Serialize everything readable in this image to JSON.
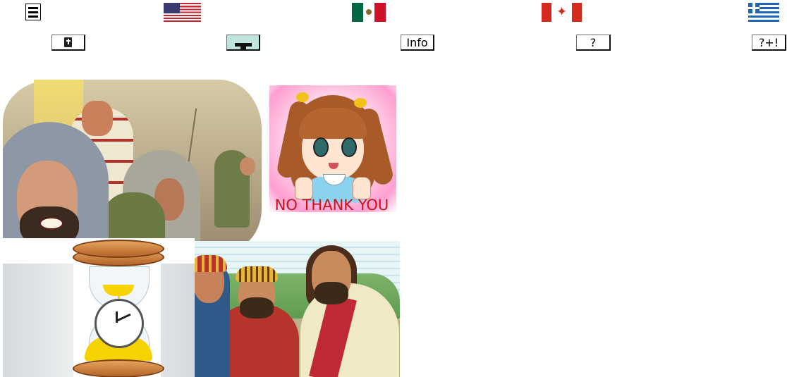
{
  "top_bar": {
    "menu_icon": "hamburger-menu-icon",
    "flags": [
      {
        "country": "United States",
        "icon": "us-flag-icon"
      },
      {
        "country": "Mexico",
        "icon": "mexico-flag-icon"
      },
      {
        "country": "Canada",
        "icon": "canada-flag-icon"
      },
      {
        "country": "Greece",
        "icon": "greece-flag-icon"
      }
    ]
  },
  "toolbar": {
    "bible_icon": "bible-icon",
    "graduation_icon": "graduation-cap-icon",
    "info_label": "Info",
    "help_label": "?",
    "help_plus_label": "?+!"
  },
  "pictures": {
    "no_thank_you_caption": "NO THANK YOU"
  },
  "colors": {
    "flag_red": "#c8232c",
    "flag_blue": "#3c3b6e",
    "mexico_green": "#006847",
    "mexico_red": "#ce1126",
    "canada_red": "#d52b1e",
    "greece_blue": "#1f65b7",
    "active_button_bg": "#bfe3dd",
    "caption_red": "#c3141f"
  }
}
